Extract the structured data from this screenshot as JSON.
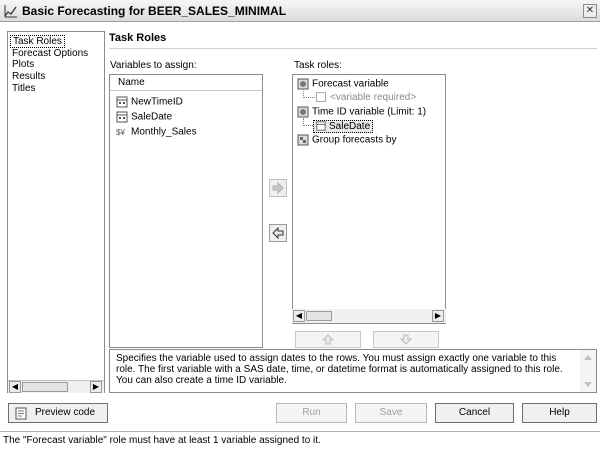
{
  "window": {
    "title": "Basic Forecasting for BEER_SALES_MINIMAL",
    "close_glyph": "✕"
  },
  "nav": {
    "items": [
      "Task Roles",
      "Forecast Options",
      "Plots",
      "Results",
      "Titles"
    ],
    "selected": "Task Roles"
  },
  "section": {
    "title": "Task Roles"
  },
  "variables": {
    "label": "Variables to assign:",
    "column_header": "Name",
    "items": [
      {
        "name": "NewTimeID",
        "icon": "date-variable-icon"
      },
      {
        "name": "SaleDate",
        "icon": "date-variable-icon"
      },
      {
        "name": "Monthly_Sales",
        "icon": "currency-variable-icon"
      }
    ]
  },
  "roles": {
    "label": "Task roles:",
    "forecast_variable": "Forecast variable",
    "variable_required": "<variable required>",
    "time_id": "Time ID variable  (Limit: 1)",
    "time_id_value": "SaleDate",
    "group_by": "Group forecasts by"
  },
  "description": "Specifies the variable used to assign dates to the rows. You must assign exactly one variable to this role. The first variable with a SAS date, time, or datetime format is automatically assigned to this role. You can also create a time ID variable.",
  "buttons": {
    "preview_code": "Preview code",
    "run": "Run",
    "save": "Save",
    "cancel": "Cancel",
    "help": "Help"
  },
  "status": "The \"Forecast variable\" role must have at least 1 variable assigned to it."
}
